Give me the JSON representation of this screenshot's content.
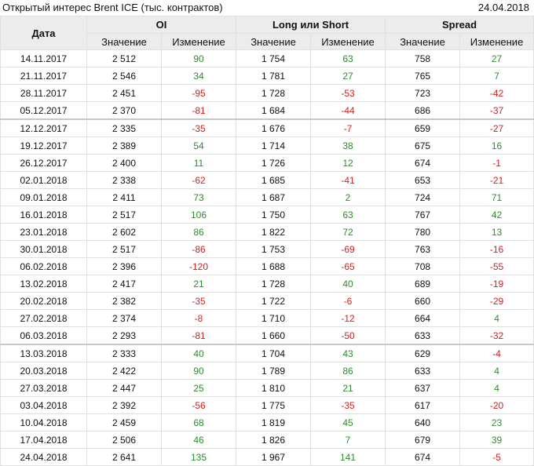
{
  "title": "Открытый интерес Brent ICE (тыс. контрактов)",
  "date": "24.04.2018",
  "header": {
    "date_col": "Дата",
    "groups": [
      "OI",
      "Long или Short",
      "Spread"
    ],
    "sub_value": "Значение",
    "sub_change": "Изменение"
  },
  "colors": {
    "positive": "#2e8b2e",
    "negative": "#d62020",
    "header_bg": "#ececec"
  },
  "rows": [
    {
      "date": "14.11.2017",
      "oi": "2 512",
      "oi_chg": "90",
      "ls": "1 754",
      "ls_chg": "63",
      "sp": "758",
      "sp_chg": "27"
    },
    {
      "date": "21.11.2017",
      "oi": "2 546",
      "oi_chg": "34",
      "ls": "1 781",
      "ls_chg": "27",
      "sp": "765",
      "sp_chg": "7"
    },
    {
      "date": "28.11.2017",
      "oi": "2 451",
      "oi_chg": "-95",
      "ls": "1 728",
      "ls_chg": "-53",
      "sp": "723",
      "sp_chg": "-42"
    },
    {
      "date": "05.12.2017",
      "oi": "2 370",
      "oi_chg": "-81",
      "ls": "1 684",
      "ls_chg": "-44",
      "sp": "686",
      "sp_chg": "-37"
    },
    {
      "date": "12.12.2017",
      "oi": "2 335",
      "oi_chg": "-35",
      "ls": "1 676",
      "ls_chg": "-7",
      "sp": "659",
      "sp_chg": "-27",
      "sep": true
    },
    {
      "date": "19.12.2017",
      "oi": "2 389",
      "oi_chg": "54",
      "ls": "1 714",
      "ls_chg": "38",
      "sp": "675",
      "sp_chg": "16"
    },
    {
      "date": "26.12.2017",
      "oi": "2 400",
      "oi_chg": "11",
      "ls": "1 726",
      "ls_chg": "12",
      "sp": "674",
      "sp_chg": "-1"
    },
    {
      "date": "02.01.2018",
      "oi": "2 338",
      "oi_chg": "-62",
      "ls": "1 685",
      "ls_chg": "-41",
      "sp": "653",
      "sp_chg": "-21"
    },
    {
      "date": "09.01.2018",
      "oi": "2 411",
      "oi_chg": "73",
      "ls": "1 687",
      "ls_chg": "2",
      "sp": "724",
      "sp_chg": "71"
    },
    {
      "date": "16.01.2018",
      "oi": "2 517",
      "oi_chg": "106",
      "ls": "1 750",
      "ls_chg": "63",
      "sp": "767",
      "sp_chg": "42"
    },
    {
      "date": "23.01.2018",
      "oi": "2 602",
      "oi_chg": "86",
      "ls": "1 822",
      "ls_chg": "72",
      "sp": "780",
      "sp_chg": "13"
    },
    {
      "date": "30.01.2018",
      "oi": "2 517",
      "oi_chg": "-86",
      "ls": "1 753",
      "ls_chg": "-69",
      "sp": "763",
      "sp_chg": "-16"
    },
    {
      "date": "06.02.2018",
      "oi": "2 396",
      "oi_chg": "-120",
      "ls": "1 688",
      "ls_chg": "-65",
      "sp": "708",
      "sp_chg": "-55"
    },
    {
      "date": "13.02.2018",
      "oi": "2 417",
      "oi_chg": "21",
      "ls": "1 728",
      "ls_chg": "40",
      "sp": "689",
      "sp_chg": "-19"
    },
    {
      "date": "20.02.2018",
      "oi": "2 382",
      "oi_chg": "-35",
      "ls": "1 722",
      "ls_chg": "-6",
      "sp": "660",
      "sp_chg": "-29"
    },
    {
      "date": "27.02.2018",
      "oi": "2 374",
      "oi_chg": "-8",
      "ls": "1 710",
      "ls_chg": "-12",
      "sp": "664",
      "sp_chg": "4"
    },
    {
      "date": "06.03.2018",
      "oi": "2 293",
      "oi_chg": "-81",
      "ls": "1 660",
      "ls_chg": "-50",
      "sp": "633",
      "sp_chg": "-32"
    },
    {
      "date": "13.03.2018",
      "oi": "2 333",
      "oi_chg": "40",
      "ls": "1 704",
      "ls_chg": "43",
      "sp": "629",
      "sp_chg": "-4",
      "sep": true
    },
    {
      "date": "20.03.2018",
      "oi": "2 422",
      "oi_chg": "90",
      "ls": "1 789",
      "ls_chg": "86",
      "sp": "633",
      "sp_chg": "4"
    },
    {
      "date": "27.03.2018",
      "oi": "2 447",
      "oi_chg": "25",
      "ls": "1 810",
      "ls_chg": "21",
      "sp": "637",
      "sp_chg": "4"
    },
    {
      "date": "03.04.2018",
      "oi": "2 392",
      "oi_chg": "-56",
      "ls": "1 775",
      "ls_chg": "-35",
      "sp": "617",
      "sp_chg": "-20"
    },
    {
      "date": "10.04.2018",
      "oi": "2 459",
      "oi_chg": "68",
      "ls": "1 819",
      "ls_chg": "45",
      "sp": "640",
      "sp_chg": "23"
    },
    {
      "date": "17.04.2018",
      "oi": "2 506",
      "oi_chg": "46",
      "ls": "1 826",
      "ls_chg": "7",
      "sp": "679",
      "sp_chg": "39"
    },
    {
      "date": "24.04.2018",
      "oi": "2 641",
      "oi_chg": "135",
      "ls": "1 967",
      "ls_chg": "141",
      "sp": "674",
      "sp_chg": "-5"
    }
  ]
}
